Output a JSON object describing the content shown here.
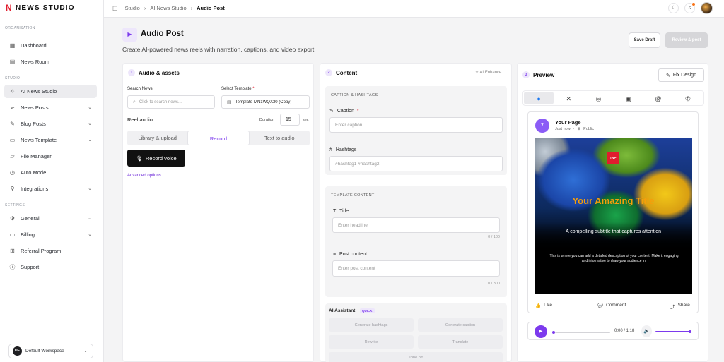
{
  "brand": {
    "logo": "N",
    "name": "NEWS STUDIO"
  },
  "sidebar": {
    "organisation_label": "ORGANISATION",
    "studio_label": "STUDIO",
    "settings_label": "SETTINGS",
    "org_items": [
      {
        "label": "Dashboard",
        "icon": "grid-icon"
      },
      {
        "label": "News Room",
        "icon": "newspaper-icon"
      }
    ],
    "studio_items": [
      {
        "label": "AI News Studio",
        "icon": "sparkle-icon",
        "active": true
      },
      {
        "label": "News Posts",
        "icon": "send-icon"
      },
      {
        "label": "Blog Posts",
        "icon": "pen-icon"
      },
      {
        "label": "News Template",
        "icon": "template-icon"
      },
      {
        "label": "File Manager",
        "icon": "folder-icon"
      },
      {
        "label": "Auto Mode",
        "icon": "clock-icon"
      },
      {
        "label": "Integrations",
        "icon": "plug-icon"
      }
    ],
    "settings_items": [
      {
        "label": "General",
        "icon": "gear-icon"
      },
      {
        "label": "Billing",
        "icon": "card-icon"
      },
      {
        "label": "Referral Program",
        "icon": "gift-icon"
      },
      {
        "label": "Support",
        "icon": "help-icon"
      }
    ],
    "workspace": {
      "initials": "DE",
      "name": "Default Workspace"
    }
  },
  "breadcrumb": [
    "Studio",
    "AI News Studio",
    "Audio Post"
  ],
  "page": {
    "title": "Audio Post",
    "subtitle": "Create AI-powered news reels with narration, captions, and video export.",
    "save_draft": "Save Draft",
    "review_post": "Review & post"
  },
  "audio": {
    "step": "1",
    "title": "Audio & assets",
    "search_label": "Search News",
    "search_placeholder": "Click to search news...",
    "template_label": "Select Template",
    "required": "*",
    "template_value": "Template-MN1WQX30 (Copy)",
    "reel_audio": "Reel audio",
    "duration_label": "Duration",
    "duration_value": "15",
    "duration_unit": "sec",
    "tabs": [
      "Library & upload",
      "Record",
      "Text to audio"
    ],
    "record_button": "Record voice",
    "advanced": "Advanced options"
  },
  "content": {
    "step": "2",
    "title": "Content",
    "ai_enhance": "AI Enhance",
    "caption_section": "CAPTION & HASHTAGS",
    "caption_label": "Caption",
    "caption_placeholder": "Enter caption",
    "hashtags_label": "Hashtags",
    "hashtags_placeholder": "#hashtag1 #hashtag2",
    "template_section": "TEMPLATE CONTENT",
    "title_label": "Title",
    "title_placeholder": "Enter headline",
    "title_count": "0 / 100",
    "post_label": "Post content",
    "post_placeholder": "Enter post content",
    "post_count": "0 / 300",
    "ai_assistant": "AI Assistant",
    "quick": "QUICK",
    "buttons": [
      "Generate hashtags",
      "Generate caption",
      "Rewrite",
      "Translate",
      "Tone off"
    ]
  },
  "preview": {
    "step": "3",
    "title": "Preview",
    "fix_design": "Fix Design",
    "socials": [
      "facebook-icon",
      "x-icon",
      "instagram-icon",
      "linkedin-icon",
      "threads-icon",
      "whatsapp-icon"
    ],
    "page_initial": "Y",
    "page_name": "Your Page",
    "meta": "Just now",
    "visibility": "Public",
    "image_logo": "TNP",
    "image_title": "Your Amazing Title",
    "image_subtitle": "A compelling subtitle that captures attention",
    "image_desc": "This is where you can add a detailed description of your content. Make it engaging and informative to draw your audience in.",
    "like": "Like",
    "comment": "Comment",
    "share": "Share",
    "time": "0:00 / 1:18"
  }
}
